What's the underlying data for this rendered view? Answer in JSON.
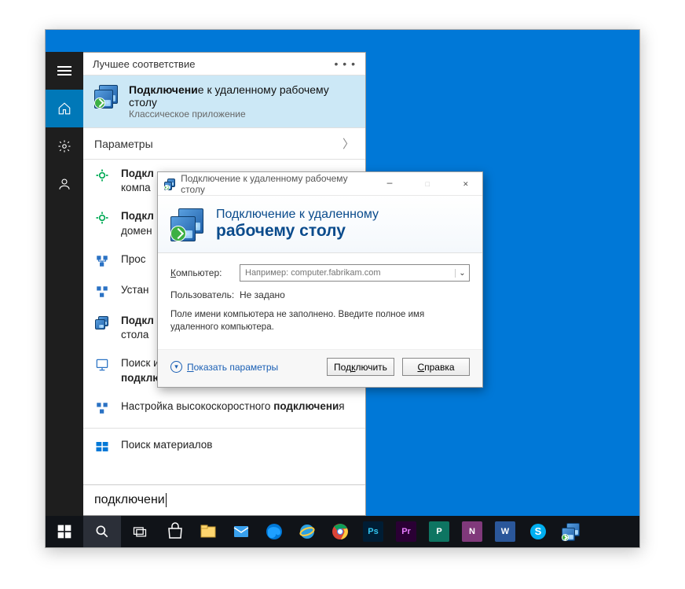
{
  "startMenu": {
    "bestMatchHeader": "Лучшее соответствие",
    "bestMatch": {
      "titleHtml": "<b>Подключени</b>е к удаленному рабочему столу",
      "subtitle": "Классическое приложение"
    },
    "settingsHeader": "Параметры",
    "results": [
      "<b>Подкл</b><br>компа",
      "<b>Подкл</b><br>домен",
      "Прос",
      "Устан",
      "<b>Подкл</b><br>стола",
      "Поиск и устранение проолел с сетью и <b>подключени</b>ем",
      "Настройка высокоскоростного <b>подключени</b>я"
    ],
    "storeResult": "Поиск материалов",
    "searchText": "подключени"
  },
  "rdp": {
    "windowTitle": "Подключение к удаленному рабочему столу",
    "headerLine1": "Подключение к удаленному",
    "headerLine2": "рабочему столу",
    "computerLabel": "Компьютер:",
    "computerPlaceholder": "Например: computer.fabrikam.com",
    "userLabel": "Пользователь:",
    "userValue": "Не задано",
    "infoText": "Поле имени компьютера не заполнено. Введите полное имя удаленного компьютера.",
    "showParams": "Показать параметры",
    "connectBtn": "Подключить",
    "helpBtn": "Справка"
  },
  "taskbar": {
    "apps": [
      "start",
      "search",
      "taskview",
      "store",
      "files",
      "mail",
      "edge",
      "ie",
      "chrome",
      "ps",
      "pr",
      "word2",
      "onenote",
      "word",
      "skype",
      "rdc"
    ]
  }
}
